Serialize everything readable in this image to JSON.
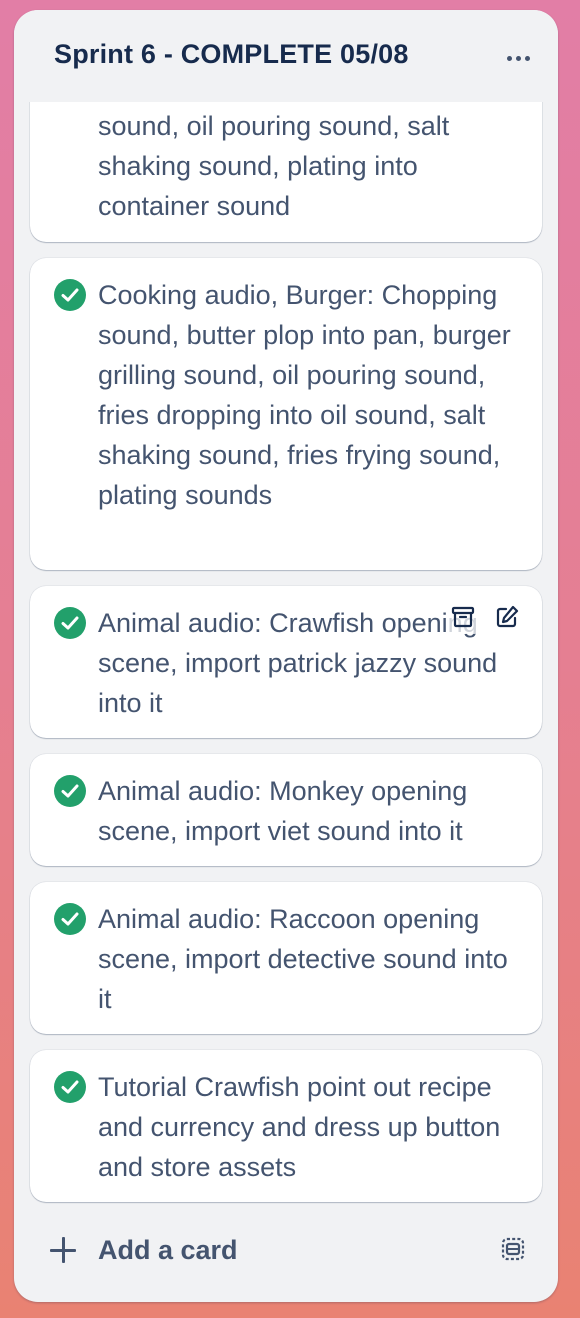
{
  "list": {
    "title": "Sprint 6 - COMPLETE 05/08",
    "more_label": "…"
  },
  "cards": [
    {
      "complete": false,
      "text": "sound, oil pouring sound, salt shaking sound, plating into container sound"
    },
    {
      "complete": true,
      "text": "Cooking audio, Burger: Chopping sound, butter plop into pan, burger grilling sound, oil pouring sound, fries dropping into oil sound, salt shaking sound, fries frying sound, plating sounds"
    },
    {
      "complete": true,
      "text": "Animal audio: Crawfish opening scene, import patrick jazzy sound into it",
      "hover_actions": [
        "archive-icon",
        "edit-icon"
      ]
    },
    {
      "complete": true,
      "text": "Animal audio: Monkey opening scene, import viet sound into it"
    },
    {
      "complete": true,
      "text": "Animal audio: Raccoon opening scene, import detective sound into it"
    },
    {
      "complete": true,
      "text": "Tutorial Crawfish point out recipe and currency and dress up button and store assets"
    }
  ],
  "footer": {
    "add_card_label": "Add a card",
    "template_icon": "card-template-icon"
  },
  "colors": {
    "check_green": "#22a06b",
    "title": "#172b4d",
    "text": "#44546f",
    "list_bg": "#f1f2f4"
  }
}
